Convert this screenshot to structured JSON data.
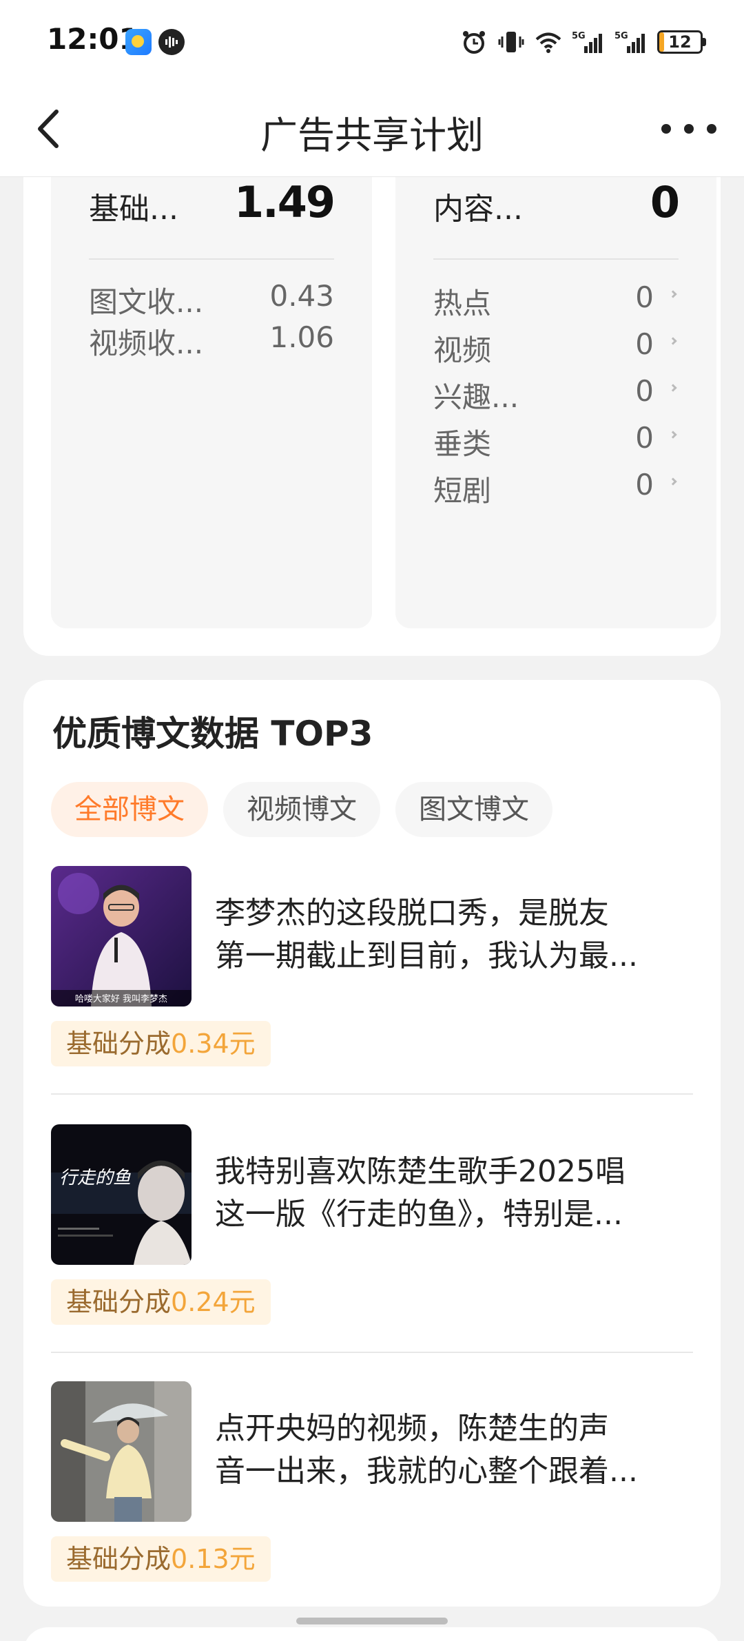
{
  "status_bar": {
    "time": "12:01",
    "battery": "12",
    "battery_level": 0.12,
    "network": "5G",
    "icons": [
      "weather-icon",
      "voice-icon",
      "alarm-icon",
      "vibrate-icon",
      "wifi-icon",
      "signal-5g-icon",
      "signal-5g-icon",
      "battery-icon"
    ]
  },
  "nav": {
    "title": "广告共享计划",
    "back_icon": "chevron-left-icon",
    "more_icon": "more-icon"
  },
  "earnings": {
    "left": {
      "label": "基础...",
      "value": "1.49",
      "rows": [
        {
          "label": "图文收...",
          "value": "0.43"
        },
        {
          "label": "视频收...",
          "value": "1.06"
        }
      ]
    },
    "right": {
      "label": "内容...",
      "value": "0",
      "rows": [
        {
          "label": "热点",
          "value": "0"
        },
        {
          "label": "视频",
          "value": "0"
        },
        {
          "label": "兴趣...",
          "value": "0"
        },
        {
          "label": "垂类",
          "value": "0"
        },
        {
          "label": "短剧",
          "value": "0"
        }
      ]
    }
  },
  "top_posts": {
    "title": "优质博文数据 TOP3",
    "tabs": [
      {
        "label": "全部博文",
        "active": true
      },
      {
        "label": "视频博文",
        "active": false
      },
      {
        "label": "图文博文",
        "active": false
      }
    ],
    "items": [
      {
        "line1": "李梦杰的这段脱口秀，是脱友",
        "line2": "第一期截止到目前，我认为最...",
        "badge_prefix": "基础分成",
        "amount": "0.34元",
        "thumb_caption": "哈喽大家好 我叫李梦杰"
      },
      {
        "line1": "我特别喜欢陈楚生歌手2025唱",
        "line2": "这一版《行走的鱼》，特别是...",
        "badge_prefix": "基础分成",
        "amount": "0.24元",
        "thumb_caption": "行走的鱼"
      },
      {
        "line1": "点开央妈的视频，陈楚生的声",
        "line2": "音一出来，我就的心整个跟着...",
        "badge_prefix": "基础分成",
        "amount": "0.13元",
        "thumb_caption": ""
      }
    ]
  },
  "colors": {
    "accent": "#ff7a2a",
    "badge_bg": "#fff4e3",
    "badge_amount": "#f3a53a",
    "background": "#f2f2f2"
  }
}
